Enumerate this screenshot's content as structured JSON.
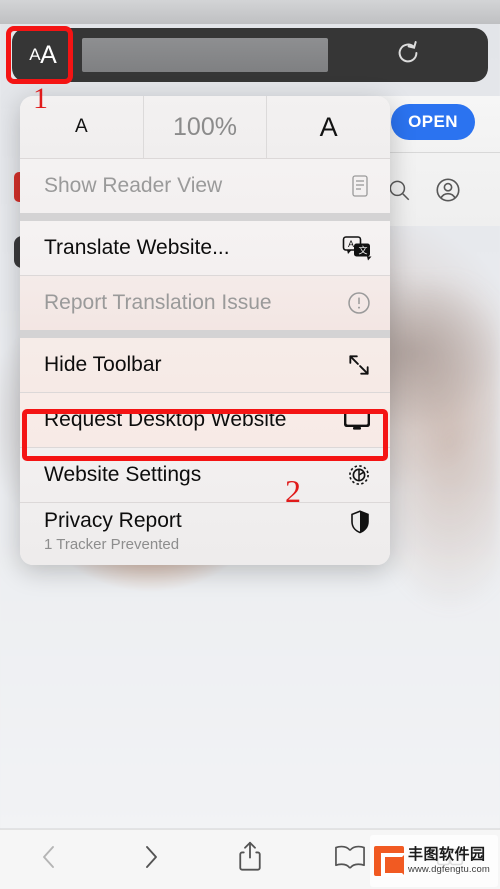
{
  "browser": {
    "address_bar": {
      "aa_button_label_small": "A",
      "aa_button_label_large": "A",
      "url_value": "",
      "url_placeholder": "",
      "reload_icon": "reload-icon"
    }
  },
  "annotations": {
    "step_1": "1",
    "step_2": "2",
    "highlight_color": "#f41414",
    "number_color": "#e01b1b"
  },
  "behind_page": {
    "open_button_label": "OPEN",
    "search_icon": "search-icon",
    "account_icon": "account-icon"
  },
  "aa_menu": {
    "font_size_row": {
      "decrease_label": "A",
      "zoom_value": "100%",
      "increase_label": "A"
    },
    "items": [
      {
        "label": "Show Reader View",
        "subtitle": "",
        "icon": "reader-view-icon",
        "disabled": true,
        "highlighted": false
      },
      {
        "label": "Translate Website...",
        "subtitle": "",
        "icon": "translate-icon",
        "disabled": false,
        "highlighted": false
      },
      {
        "label": "Report Translation Issue",
        "subtitle": "",
        "icon": "exclamation-circle-icon",
        "disabled": true,
        "highlighted": false
      },
      {
        "label": "Hide Toolbar",
        "subtitle": "",
        "icon": "expand-arrows-icon",
        "disabled": false,
        "highlighted": false
      },
      {
        "label": "Request Desktop Website",
        "subtitle": "",
        "icon": "desktop-monitor-icon",
        "disabled": false,
        "highlighted": true
      },
      {
        "label": "Website Settings",
        "subtitle": "",
        "icon": "gear-icon",
        "disabled": false,
        "highlighted": false
      },
      {
        "label": "Privacy Report",
        "subtitle": "1 Tracker Prevented",
        "icon": "shield-icon",
        "disabled": false,
        "highlighted": false
      }
    ]
  },
  "bottom_toolbar": {
    "back_icon": "chevron-left-icon",
    "forward_icon": "chevron-right-icon",
    "share_icon": "share-icon",
    "bookmarks_icon": "book-icon",
    "tabs_icon": "tabs-icon"
  },
  "watermark": {
    "name": "丰图软件园",
    "url": "www.dgfengtu.com"
  }
}
